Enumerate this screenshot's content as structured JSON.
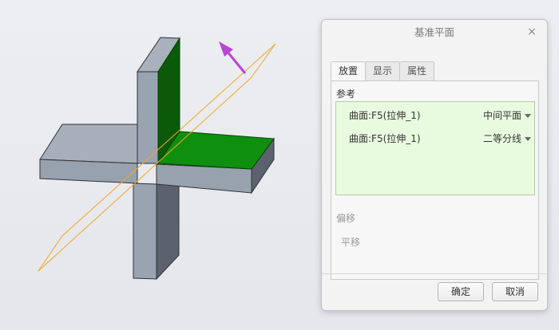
{
  "dialog": {
    "title": "基准平面",
    "close_glyph": "×",
    "tabs": [
      {
        "label": "放置",
        "active": true
      },
      {
        "label": "显示",
        "active": false
      },
      {
        "label": "属性",
        "active": false
      }
    ],
    "references_label": "参考",
    "references": [
      {
        "surface": "曲面:F5(拉伸_1)",
        "constraint": "中间平面"
      },
      {
        "surface": "曲面:F5(拉伸_1)",
        "constraint": "二等分线"
      }
    ],
    "offset_label": "偏移",
    "translate_label": "平移",
    "ok_label": "确定",
    "cancel_label": "取消"
  },
  "viewport": {
    "icons": [
      "direction-arrow-icon"
    ],
    "colors": {
      "selected_face": "#008000",
      "part_body": "#9aa3b1",
      "datum_plane_outline": "#f5a623",
      "direction_arrow": "#b847d6"
    }
  }
}
